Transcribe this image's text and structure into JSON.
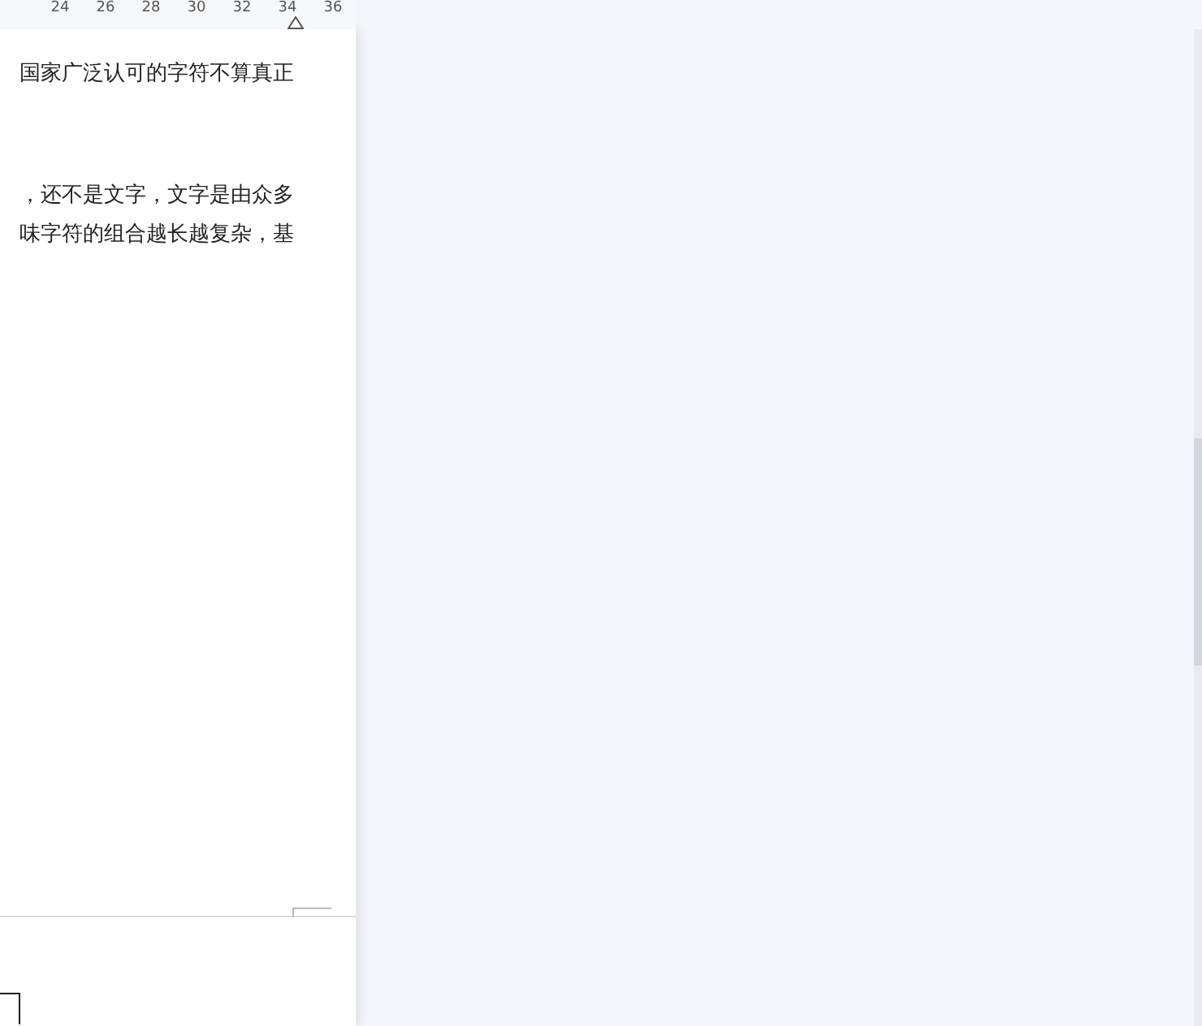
{
  "ruler": {
    "ticks": [
      "24",
      "26",
      "28",
      "30",
      "32",
      "34",
      "36"
    ]
  },
  "document": {
    "paragraphs": [
      {
        "lines": [
          "国家广泛认可的字符不算真正"
        ]
      },
      {
        "lines": [
          "，还不是文字，文字是由众多",
          "味字符的组合越长越复杂，基"
        ]
      }
    ]
  }
}
